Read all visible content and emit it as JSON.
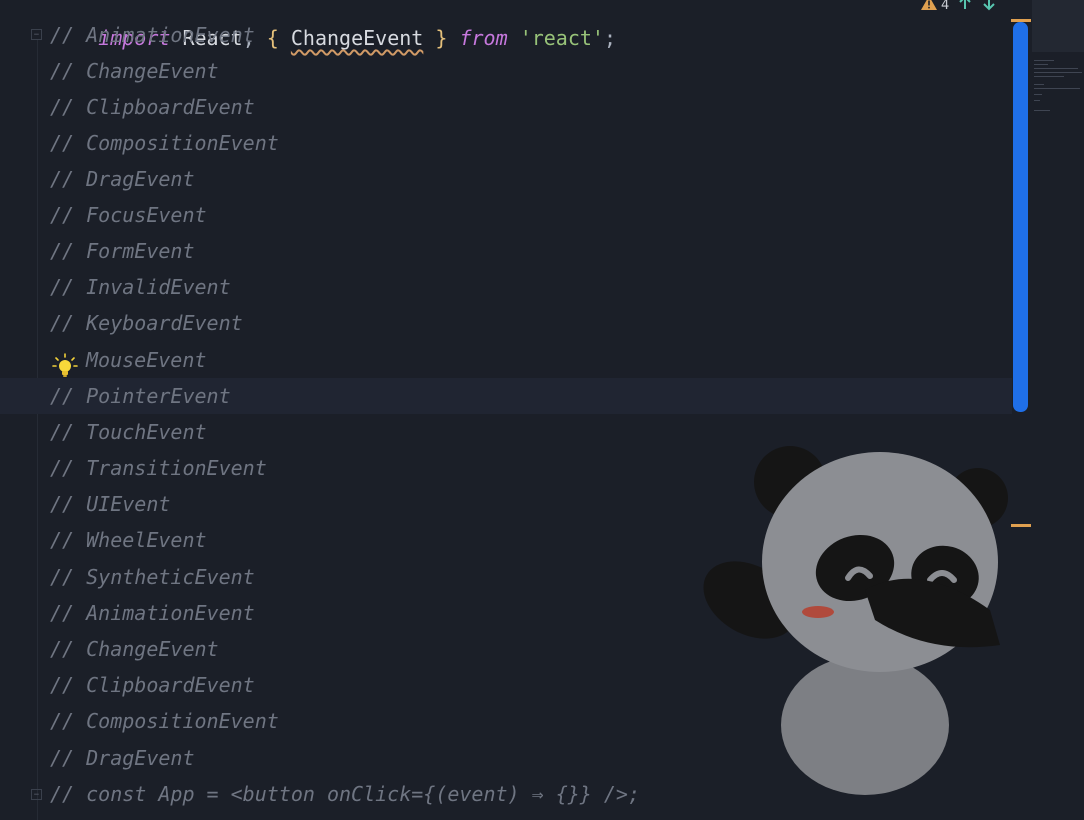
{
  "editor": {
    "first_line": {
      "keyword_import": "import",
      "ident_react": "React",
      "comma": ",",
      "brace_open": "{",
      "ident_change_event": "ChangeEvent",
      "brace_close": "}",
      "keyword_from": "from",
      "string_react": "'react'",
      "semicolon": ";"
    },
    "status": {
      "warning_count": "4"
    },
    "lines": [
      "// AnimationEvent",
      "// ChangeEvent",
      "// ClipboardEvent",
      "// CompositionEvent",
      "// DragEvent",
      "// FocusEvent",
      "// FormEvent",
      "// InvalidEvent",
      "// KeyboardEvent",
      "MouseEvent",
      "// PointerEvent",
      "// TouchEvent",
      "// TransitionEvent",
      "// UIEvent",
      "// WheelEvent",
      "// SyntheticEvent",
      "// AnimationEvent",
      "// ChangeEvent",
      "// ClipboardEvent",
      "// CompositionEvent",
      "// DragEvent",
      "// const App = <button onClick={(event) ⇒ {}} />;"
    ],
    "lightbulb_line_index": 9,
    "current_line_index": 10
  },
  "colors": {
    "background": "#1b1f28",
    "comment": "#6f7582",
    "keyword": "#c678dd",
    "string": "#98c379",
    "brace": "#e5c07b",
    "scrollbar_thumb": "#1f6fe8",
    "warning": "#e0a050"
  },
  "icons": {
    "lightbulb": "lightbulb-icon",
    "warning": "warning-icon",
    "arrow_up": "arrow-up-icon",
    "arrow_down": "arrow-down-icon",
    "panda": "panda-mascot"
  }
}
